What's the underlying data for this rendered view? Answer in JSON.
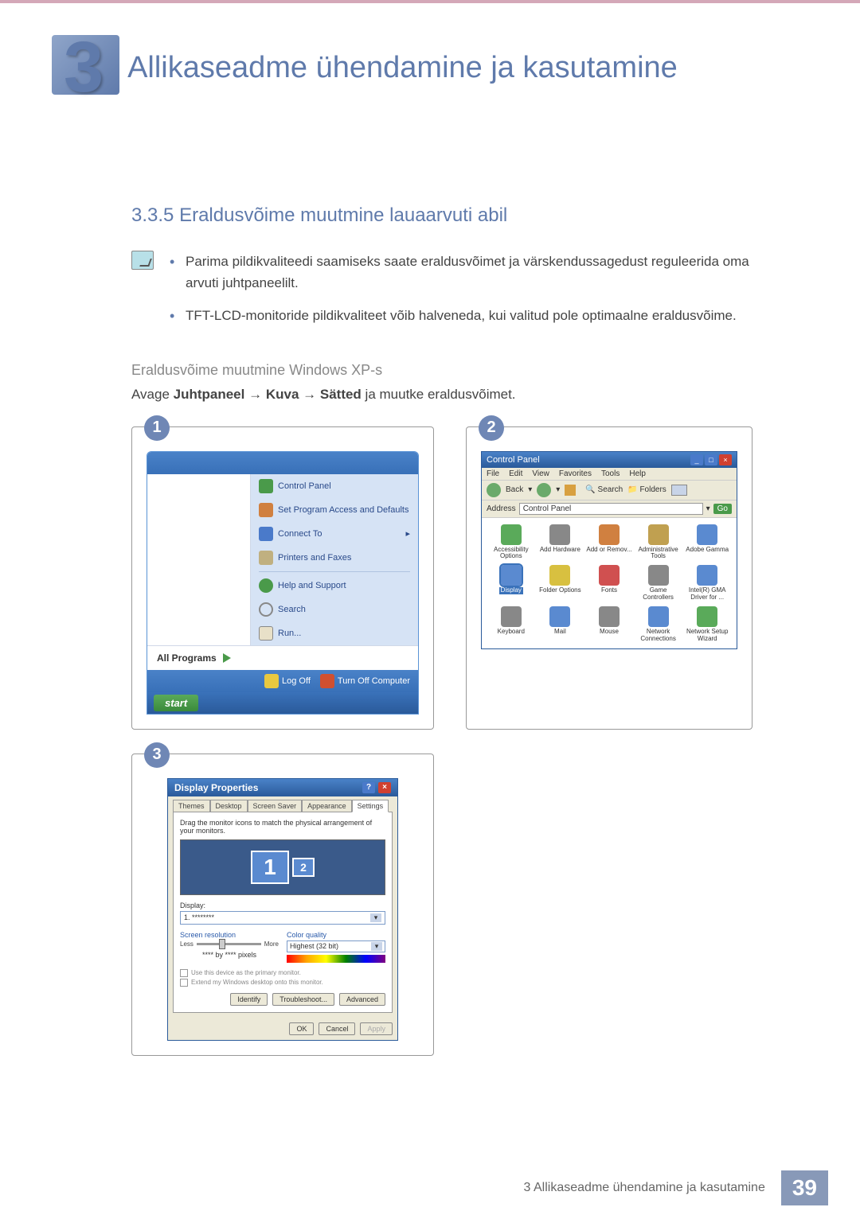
{
  "header": {
    "chapter_number": "3",
    "chapter_title": "Allikaseadme ühendamine ja kasutamine"
  },
  "section": {
    "number": "3.3.5",
    "title": "Eraldusvõime muutmine lauaarvuti abil"
  },
  "bullets": [
    "Parima pildikvaliteedi saamiseks saate eraldusvõimet ja värskendussagedust reguleerida oma arvuti juhtpaneelilt.",
    "TFT-LCD-monitoride pildikvaliteet võib halveneda, kui valitud pole optimaalne eraldusvõime."
  ],
  "subsection_title": "Eraldusvõime muutmine Windows XP-s",
  "instruction": {
    "prefix": "Avage ",
    "b1": "Juhtpaneel",
    "arrow": " → ",
    "b2": "Kuva",
    "b3": "Sätted",
    "suffix": " ja muutke eraldusvõimet."
  },
  "steps": {
    "s1": "1",
    "s2": "2",
    "s3": "3"
  },
  "start_menu": {
    "items": [
      "Control Panel",
      "Set Program Access and Defaults",
      "Connect To",
      "Printers and Faxes",
      "Help and Support",
      "Search",
      "Run..."
    ],
    "all_programs": "All Programs",
    "log_off": "Log Off",
    "turn_off": "Turn Off Computer",
    "start": "start"
  },
  "control_panel": {
    "title": "Control Panel",
    "menus": [
      "File",
      "Edit",
      "View",
      "Favorites",
      "Tools",
      "Help"
    ],
    "back": "Back",
    "search": "Search",
    "folders": "Folders",
    "address_label": "Address",
    "address_value": "Control Panel",
    "go": "Go",
    "items": [
      "Accessibility Options",
      "Add Hardware",
      "Add or Remov...",
      "Administrative Tools",
      "Adobe Gamma",
      "Display",
      "Folder Options",
      "Fonts",
      "Game Controllers",
      "Intel(R) GMA Driver for ...",
      "Keyboard",
      "Mail",
      "Mouse",
      "Network Connections",
      "Network Setup Wizard"
    ],
    "selected_index": 5
  },
  "display_props": {
    "title": "Display Properties",
    "tabs": [
      "Themes",
      "Desktop",
      "Screen Saver",
      "Appearance",
      "Settings"
    ],
    "active_tab": 4,
    "hint": "Drag the monitor icons to match the physical arrangement of your monitors.",
    "mon1": "1",
    "mon2": "2",
    "display_label": "Display:",
    "display_value": "1. ********",
    "res_label": "Screen resolution",
    "less": "Less",
    "more": "More",
    "res_value": "**** by **** pixels",
    "cq_label": "Color quality",
    "cq_value": "Highest (32 bit)",
    "chk1": "Use this device as the primary monitor.",
    "chk2": "Extend my Windows desktop onto this monitor.",
    "identify": "Identify",
    "troubleshoot": "Troubleshoot...",
    "advanced": "Advanced",
    "ok": "OK",
    "cancel": "Cancel",
    "apply": "Apply"
  },
  "footer": {
    "text": "3 Allikaseadme ühendamine ja kasutamine",
    "page": "39"
  }
}
